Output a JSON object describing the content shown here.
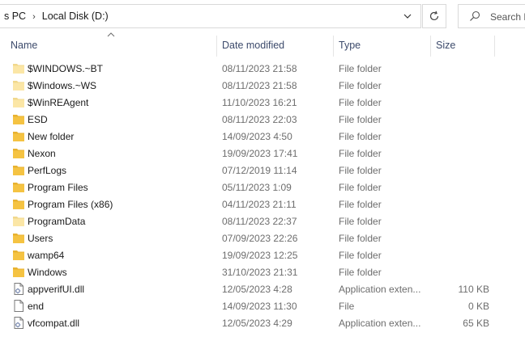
{
  "address_bar": {
    "crumbs": [
      "s PC",
      "Local Disk (D:)"
    ],
    "separator": "›"
  },
  "search": {
    "placeholder": "Search L"
  },
  "columns": {
    "name": "Name",
    "date": "Date modified",
    "type": "Type",
    "size": "Size"
  },
  "files": [
    {
      "name": "$WINDOWS.~BT",
      "date": "08/11/2023 21:58",
      "type": "File folder",
      "size": "",
      "icon": "folder-light-icon"
    },
    {
      "name": "$Windows.~WS",
      "date": "08/11/2023 21:58",
      "type": "File folder",
      "size": "",
      "icon": "folder-light-icon"
    },
    {
      "name": "$WinREAgent",
      "date": "11/10/2023 16:21",
      "type": "File folder",
      "size": "",
      "icon": "folder-light-icon"
    },
    {
      "name": "ESD",
      "date": "08/11/2023 22:03",
      "type": "File folder",
      "size": "",
      "icon": "folder-icon"
    },
    {
      "name": "New folder",
      "date": "14/09/2023 4:50",
      "type": "File folder",
      "size": "",
      "icon": "folder-icon"
    },
    {
      "name": "Nexon",
      "date": "19/09/2023 17:41",
      "type": "File folder",
      "size": "",
      "icon": "folder-icon"
    },
    {
      "name": "PerfLogs",
      "date": "07/12/2019 11:14",
      "type": "File folder",
      "size": "",
      "icon": "folder-icon"
    },
    {
      "name": "Program Files",
      "date": "05/11/2023 1:09",
      "type": "File folder",
      "size": "",
      "icon": "folder-icon"
    },
    {
      "name": "Program Files (x86)",
      "date": "04/11/2023 21:11",
      "type": "File folder",
      "size": "",
      "icon": "folder-icon"
    },
    {
      "name": "ProgramData",
      "date": "08/11/2023 22:37",
      "type": "File folder",
      "size": "",
      "icon": "folder-light-icon"
    },
    {
      "name": "Users",
      "date": "07/09/2023 22:26",
      "type": "File folder",
      "size": "",
      "icon": "folder-icon"
    },
    {
      "name": "wamp64",
      "date": "19/09/2023 12:25",
      "type": "File folder",
      "size": "",
      "icon": "folder-icon"
    },
    {
      "name": "Windows",
      "date": "31/10/2023 21:31",
      "type": "File folder",
      "size": "",
      "icon": "folder-icon"
    },
    {
      "name": "appverifUI.dll",
      "date": "12/05/2023 4:28",
      "type": "Application exten...",
      "size": "110 KB",
      "icon": "dll-file-icon"
    },
    {
      "name": "end",
      "date": "14/09/2023 11:30",
      "type": "File",
      "size": "0 KB",
      "icon": "file-icon"
    },
    {
      "name": "vfcompat.dll",
      "date": "12/05/2023 4:29",
      "type": "Application exten...",
      "size": "65 KB",
      "icon": "dll-file-icon"
    }
  ],
  "colors": {
    "folder": "#f5c342",
    "folder_light": "#fbe6a6",
    "header_text": "#3c4a6b",
    "secondary_text": "#6d6d6d"
  }
}
